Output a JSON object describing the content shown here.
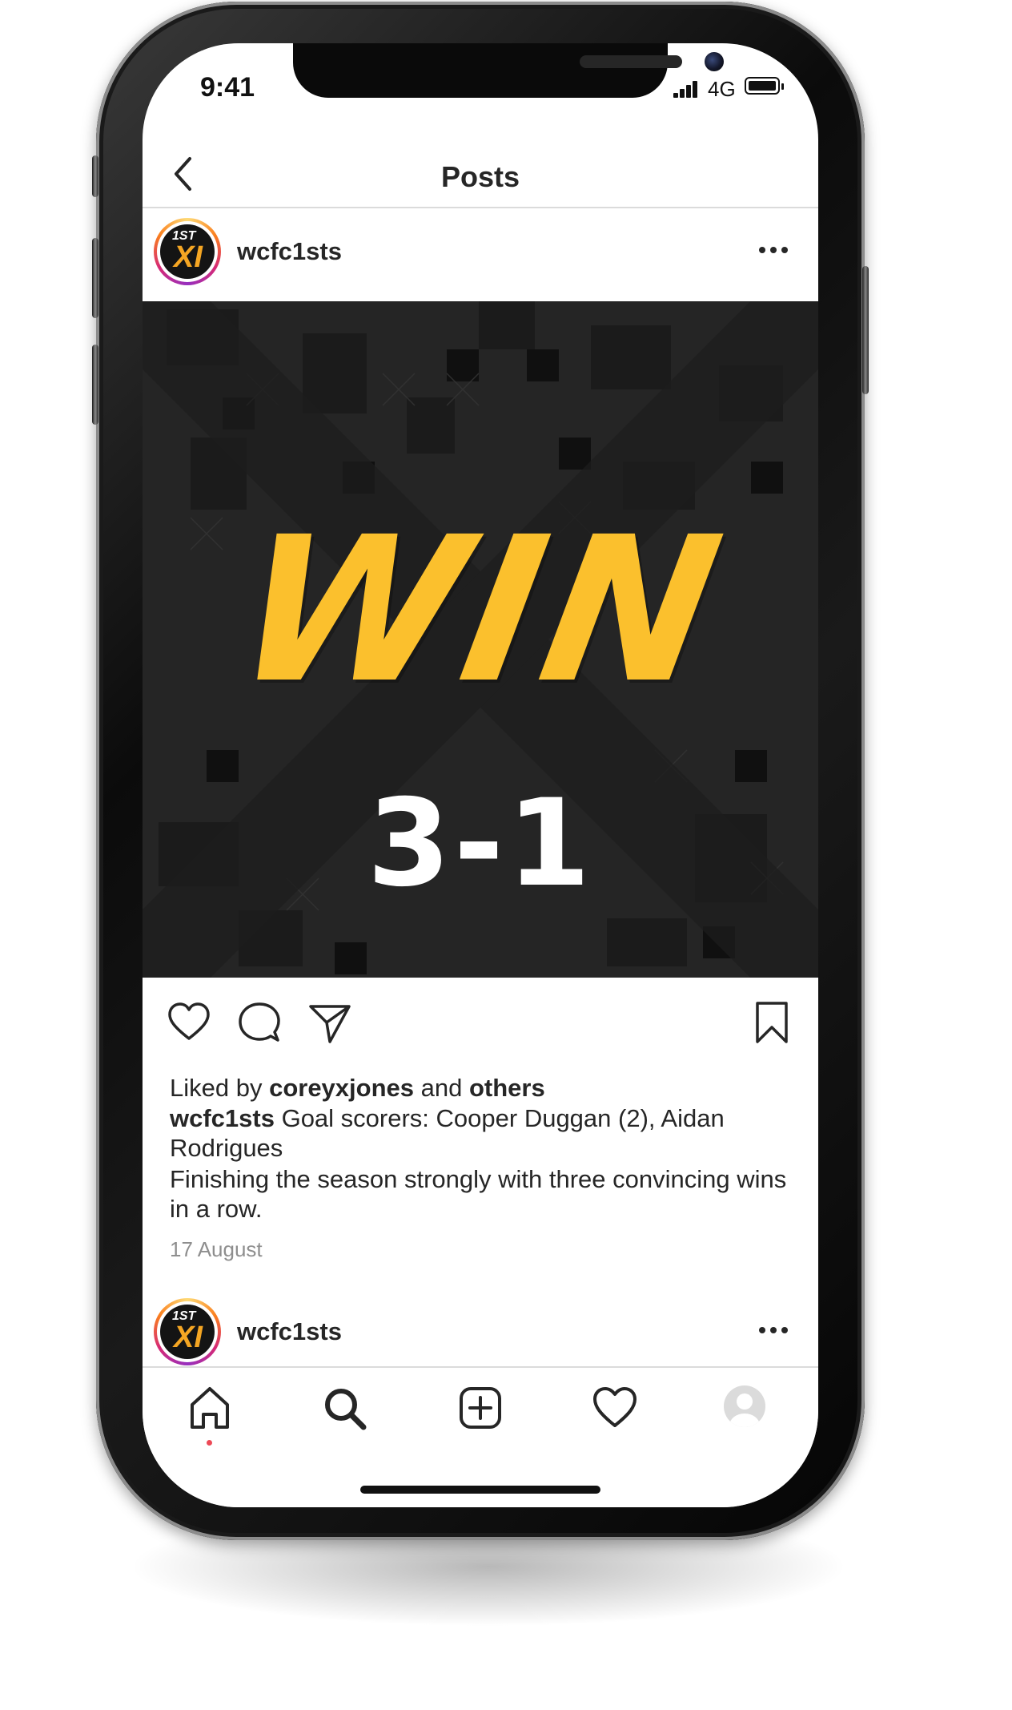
{
  "status_bar": {
    "time": "9:41",
    "network": "4G"
  },
  "nav": {
    "title": "Posts"
  },
  "post": {
    "username": "wcfc1sts",
    "image": {
      "headline": "WIN",
      "score": "3-1"
    },
    "likes": {
      "prefix": "Liked by ",
      "user": "coreyxjones",
      "middle": " and ",
      "others": "others"
    },
    "caption": {
      "username": "wcfc1sts",
      "text": " Goal scorers: Cooper Duggan (2), Aidan Rodrigues",
      "text2": "Finishing the season strongly with three convincing wins in a row."
    },
    "date": "17 August"
  },
  "avatar": {
    "small": "1ST",
    "big": "XI"
  },
  "next_post": {
    "username": "wcfc1sts"
  },
  "colors": {
    "brand_yellow": "#fbc02d",
    "background_dark": "#232323",
    "notification_dot": "#ed4956"
  },
  "icons": [
    "back-chevron-icon",
    "more-dots-icon",
    "heart-icon",
    "comment-icon",
    "share-icon",
    "bookmark-icon",
    "home-icon",
    "search-icon",
    "add-post-icon",
    "activity-heart-icon",
    "profile-icon"
  ]
}
